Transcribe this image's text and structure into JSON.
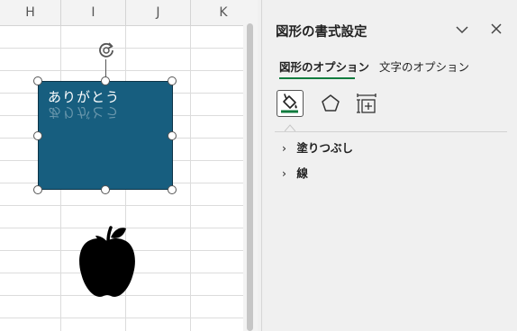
{
  "columns": [
    "H",
    "I",
    "J",
    "K"
  ],
  "shape": {
    "text": "ありがとう",
    "fill_color": "#175e7f"
  },
  "pane": {
    "title": "図形の書式設定",
    "tabs": [
      {
        "label": "図形のオプション",
        "selected": true
      },
      {
        "label": "文字のオプション",
        "selected": false
      }
    ],
    "icons": [
      "fill-line-icon",
      "effects-pentagon-icon",
      "size-properties-icon"
    ],
    "sections": [
      {
        "label": "塗りつぶし",
        "expanded": false
      },
      {
        "label": "線",
        "expanded": false
      }
    ]
  },
  "colors": {
    "accent_green": "#0f7b3e",
    "shape_fill": "#175e7f"
  }
}
